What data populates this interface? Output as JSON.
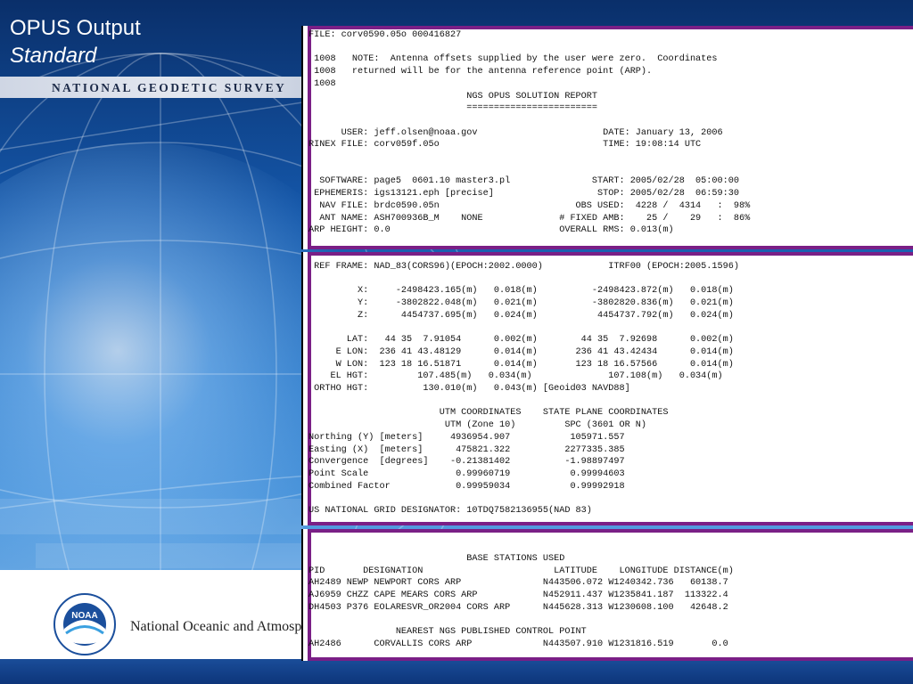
{
  "slide": {
    "title_line1": "OPUS Output",
    "title_line2": "Standard",
    "agency_banner": "NATIONAL GEODETIC SURVEY",
    "logo_text": "NOAA",
    "footer_org": "National Oceanic and Atmosph"
  },
  "report": {
    "header": [
      "FILE: corv0590.05o 000416827",
      "",
      " 1008   NOTE:  Antenna offsets supplied by the user were zero.  Coordinates",
      " 1008   returned will be for the antenna reference point (ARP).",
      " 1008",
      "                             NGS OPUS SOLUTION REPORT",
      "                             ========================",
      "",
      "      USER: jeff.olsen@noaa.gov                       DATE: January 13, 2006",
      "RINEX FILE: corv059f.05o                              TIME: 19:08:14 UTC",
      "",
      "",
      "  SOFTWARE: page5  0601.10 master3.pl               START: 2005/02/28  05:00:00",
      " EPHEMERIS: igs13121.eph [precise]                   STOP: 2005/02/28  06:59:30",
      "  NAV FILE: brdc0590.05n                         OBS USED:  4228 /  4314   :  98%",
      "  ANT NAME: ASH700936B_M    NONE              # FIXED AMB:    25 /    29   :  86%",
      "ARP HEIGHT: 0.0                               OVERALL RMS: 0.013(m)"
    ],
    "coordinates": [
      " REF FRAME: NAD_83(CORS96)(EPOCH:2002.0000)            ITRF00 (EPOCH:2005.1596)",
      "",
      "         X:     -2498423.165(m)   0.018(m)          -2498423.872(m)   0.018(m)",
      "         Y:     -3802822.048(m)   0.021(m)          -3802820.836(m)   0.021(m)",
      "         Z:      4454737.695(m)   0.024(m)           4454737.792(m)   0.024(m)",
      "",
      "       LAT:   44 35  7.91054      0.002(m)        44 35  7.92698      0.002(m)",
      "     E LON:  236 41 43.48129      0.014(m)       236 41 43.42434      0.014(m)",
      "     W LON:  123 18 16.51871      0.014(m)       123 18 16.57566      0.014(m)",
      "    EL HGT:         107.485(m)   0.034(m)              107.108(m)   0.034(m)",
      " ORTHO HGT:          130.010(m)   0.043(m) [Geoid03 NAVD88]",
      "",
      "                        UTM COORDINATES    STATE PLANE COORDINATES",
      "                         UTM (Zone 10)         SPC (3601 OR N)",
      "Northing (Y) [meters]     4936954.907           105971.557",
      "Easting (X)  [meters]      475821.322          2277335.385",
      "Convergence  [degrees]    -0.21381402          -1.98897497",
      "Point Scale                0.99960719           0.99994603",
      "Combined Factor            0.99959034           0.99992918",
      "",
      "US NATIONAL GRID DESIGNATOR: 10TDQ7582136955(NAD 83)"
    ],
    "base_stations": [
      "                             BASE STATIONS USED",
      "PID       DESIGNATION                        LATITUDE    LONGITUDE DISTANCE(m)",
      "AH2489 NEWP NEWPORT CORS ARP               N443506.072 W1240342.736   60138.7",
      "AJ6959 CHZZ CAPE MEARS CORS ARP            N452911.437 W1235841.187  113322.4",
      "DH4503 P376 EOLARESVR_OR2004 CORS ARP      N445628.313 W1230608.100   42648.2",
      "",
      "                NEAREST NGS PUBLISHED CONTROL POINT",
      "AH2486      CORVALLIS CORS ARP             N443507.910 W1231816.519       0.0"
    ]
  }
}
